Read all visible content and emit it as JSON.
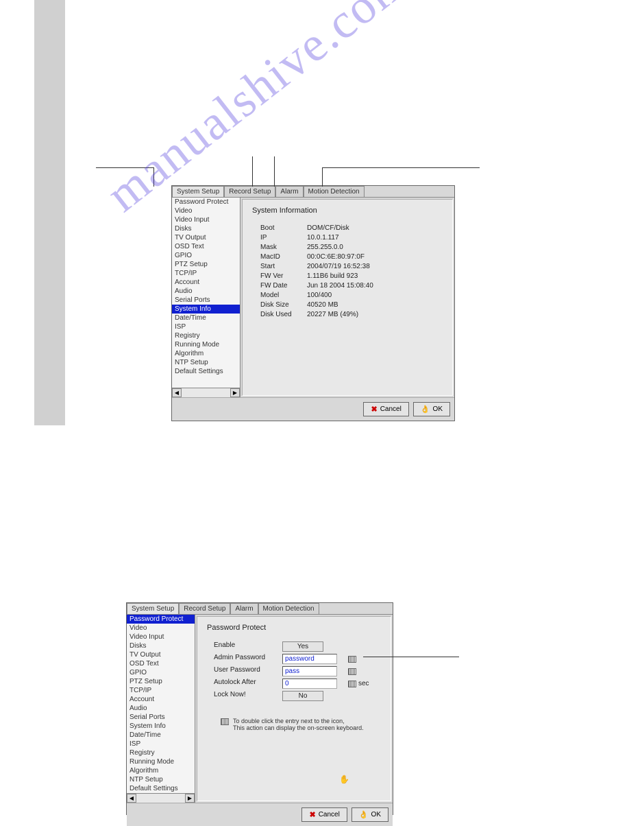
{
  "watermark": "manualshive.com",
  "tabs": [
    "System Setup",
    "Record Setup",
    "Alarm",
    "Motion Detection"
  ],
  "sidebar": {
    "items": [
      "Password Protect",
      "Video",
      "Video Input",
      "Disks",
      "TV Output",
      "OSD Text",
      "GPIO",
      "PTZ Setup",
      "TCP/IP",
      "Account",
      "Audio",
      "Serial Ports",
      "System Info",
      "Date/Time",
      "ISP",
      "Registry",
      "Running Mode",
      "Algorithm",
      "NTP Setup",
      "Default Settings"
    ]
  },
  "dialog1": {
    "title": "System Information",
    "rows": [
      {
        "label": "Boot",
        "value": "DOM/CF/Disk"
      },
      {
        "label": "IP",
        "value": "10.0.1.117"
      },
      {
        "label": "Mask",
        "value": "255.255.0.0"
      },
      {
        "label": "MacID",
        "value": "00:0C:6E:80:97:0F"
      },
      {
        "label": "Start",
        "value": "2004/07/19 16:52:38"
      },
      {
        "label": "FW Ver",
        "value": "1.11B6 build 923"
      },
      {
        "label": "FW Date",
        "value": "Jun 18 2004 15:08:40"
      },
      {
        "label": "Model",
        "value": "100/400"
      },
      {
        "label": "Disk Size",
        "value": "40520 MB"
      },
      {
        "label": "Disk Used",
        "value": "20227 MB (49%)"
      }
    ]
  },
  "dialog2": {
    "title": "Password Protect",
    "enable_label": "Enable",
    "enable_value": "Yes",
    "admin_label": "Admin Password",
    "admin_value": "password",
    "user_label": "User Password",
    "user_value": "pass",
    "autolock_label": "Autolock After",
    "autolock_value": "0",
    "autolock_unit": "sec",
    "locknow_label": "Lock Now!",
    "locknow_value": "No",
    "hint": "To double click the entry next to the icon,\nThis action can display the on-screen keyboard."
  },
  "buttons": {
    "cancel": "Cancel",
    "ok": "OK"
  }
}
